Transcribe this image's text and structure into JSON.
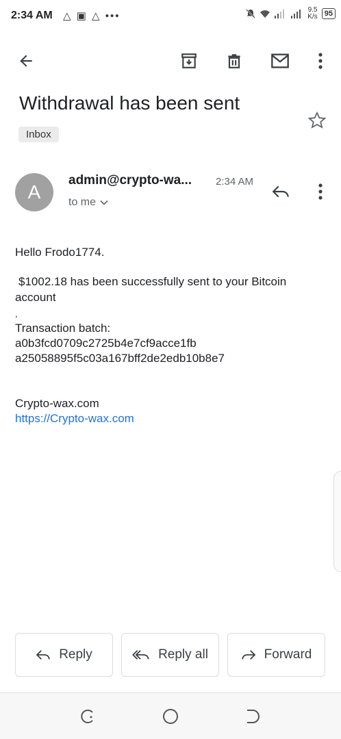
{
  "status_bar": {
    "time": "2:34 AM",
    "left_icons": "△ ▣ △ •••",
    "speed_value": "9.5",
    "speed_unit": "K/s",
    "battery": "95"
  },
  "email": {
    "subject": "Withdrawal has been sent",
    "label": "Inbox",
    "avatar_letter": "A",
    "sender": "admin@crypto-wa...",
    "time": "2:34 AM",
    "recipient": "to me",
    "body": {
      "greeting": "Hello Frodo1774.",
      "line1": "$1002.18 has been successfully sent to your Bitcoin",
      "line2": "account",
      "comma": ",",
      "batch_label": "Transaction batch:",
      "batch_line1": "a0b3fcd0709c2725b4e7cf9acce1fb",
      "batch_line2": "a25058895f5c03a167bff2de2edb10b8e7",
      "signature": "Crypto-wax.com",
      "signature_link": "https://Crypto-wax.com"
    }
  },
  "actions": {
    "reply": "Reply",
    "reply_all": "Reply all",
    "forward": "Forward"
  },
  "colors": {
    "link": "#1a73e8",
    "avatar": "#a1a1a1",
    "chip_bg": "#ebebeb"
  }
}
